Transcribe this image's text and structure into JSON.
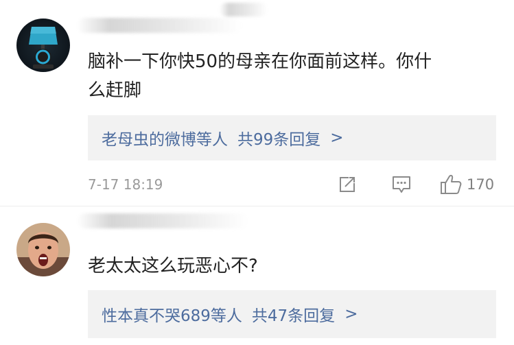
{
  "comments": [
    {
      "avatar_icon": "lamp-avatar",
      "text_line1": "脑补一下你快50的母亲在你面前这样。你什",
      "text_line2": "么赶脚",
      "replies": {
        "users": "老母虫的微博等人",
        "count": "共99条回复",
        "chevron": ">"
      },
      "timestamp": "7-17 18:19",
      "like_count": "170",
      "icons": [
        "share-icon",
        "comment-icon",
        "thumbs-up-icon"
      ]
    },
    {
      "avatar_icon": "person-avatar",
      "text_line1": "老太太这么玩恶心不?",
      "replies": {
        "users": "性本真不哭689等人",
        "count": "共47条回复",
        "chevron": ">"
      }
    }
  ],
  "colors": {
    "reply_link": "#4d6c9e",
    "reply_bg": "#f2f2f2",
    "meta_text": "#9a9a9a"
  }
}
